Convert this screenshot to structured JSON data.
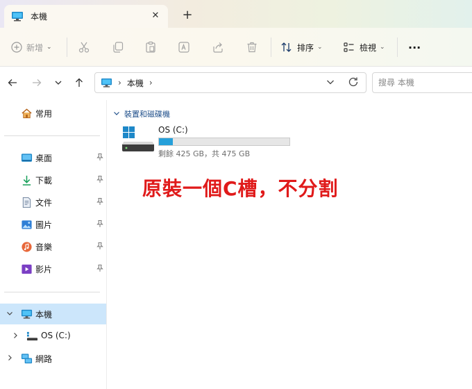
{
  "window": {
    "tab_title": "本機",
    "tab_close": "✕",
    "new_tab": "+"
  },
  "toolbar": {
    "new_label": "新增",
    "sort_label": "排序",
    "view_label": "檢視",
    "more": "···"
  },
  "address": {
    "location": "本機",
    "search_placeholder": "搜尋 本機"
  },
  "sidebar": {
    "home": "常用",
    "quick_access": [
      {
        "label": "桌面",
        "icon": "desktop-icon"
      },
      {
        "label": "下載",
        "icon": "download-icon"
      },
      {
        "label": "文件",
        "icon": "document-icon"
      },
      {
        "label": "圖片",
        "icon": "picture-icon"
      },
      {
        "label": "音樂",
        "icon": "music-icon"
      },
      {
        "label": "影片",
        "icon": "video-icon"
      }
    ],
    "this_pc": "本機",
    "os_drive": "OS (C:)",
    "network": "網路"
  },
  "content": {
    "group_title": "裝置和磁碟機",
    "drive": {
      "name": "OS (C:)",
      "free_text": "剩餘 425 GB，共 475 GB",
      "used_fraction": 0.105
    },
    "annotation": "原裝一個C槽，不分割"
  },
  "colors": {
    "accent": "#0067c0",
    "selection": "#cce6fb",
    "drive_fill": "#26a0da",
    "annotation": "#e01a1a"
  }
}
